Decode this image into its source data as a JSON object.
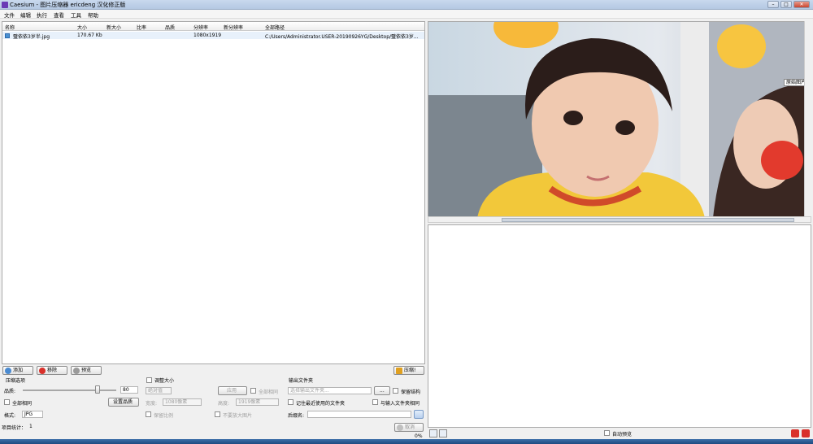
{
  "window": {
    "title": "Caesium - 图片压缩器 ericdeng 汉化修正版"
  },
  "menu": [
    "文件",
    "编辑",
    "执行",
    "查看",
    "工具",
    "帮助"
  ],
  "list": {
    "columns": [
      "名称",
      "大小",
      "新大小",
      "比率",
      "品质",
      "分辨率",
      "新分辨率",
      "全部路径"
    ],
    "rows": [
      {
        "name": "璧依依3岁半.jpg",
        "size": "170.67 Kb",
        "new_size": "",
        "ratio": "",
        "quality": "",
        "resolution": "1080x1919",
        "new_resolution": "",
        "path": "C:/Users/Administrator.USER-20190926YG/Desktop/璧依依3岁..."
      }
    ]
  },
  "toolbar": {
    "add": "添加",
    "remove": "移除",
    "preview": "预览",
    "compress": "压缩!"
  },
  "options": {
    "compression_group": "压缩选项",
    "quality_label": "品质:",
    "quality_value": "80",
    "same_for_all": "全部相同",
    "set_quality": "设置品质",
    "format_label": "格式:",
    "format_value": "JPG",
    "resize_label": "调整大小",
    "resize_mode": "绝对值",
    "apply": "应用",
    "apply_all": "全部相同",
    "width_label": "宽度:",
    "width_value": "1080像素",
    "height_label": "高度:",
    "height_value": "1919像素",
    "keep_ratio": "保留比例",
    "no_enlarge": "不要放大图片",
    "output_group": "输出文件夹",
    "output_placeholder": "选择输出文件夹...",
    "browse": "...",
    "keep_structure": "保留结构",
    "remember_last": "记住最近使用的文件夹",
    "same_as_input": "与输入文件夹相同",
    "suffix_label": "后缀名:",
    "suffix_value": ""
  },
  "status": {
    "items_label": "项目统计：",
    "items_count": "1",
    "cancel": "取消",
    "progress": "0%"
  },
  "preview": {
    "original_tooltip": "原始图片",
    "auto_preview": "自动预览"
  }
}
